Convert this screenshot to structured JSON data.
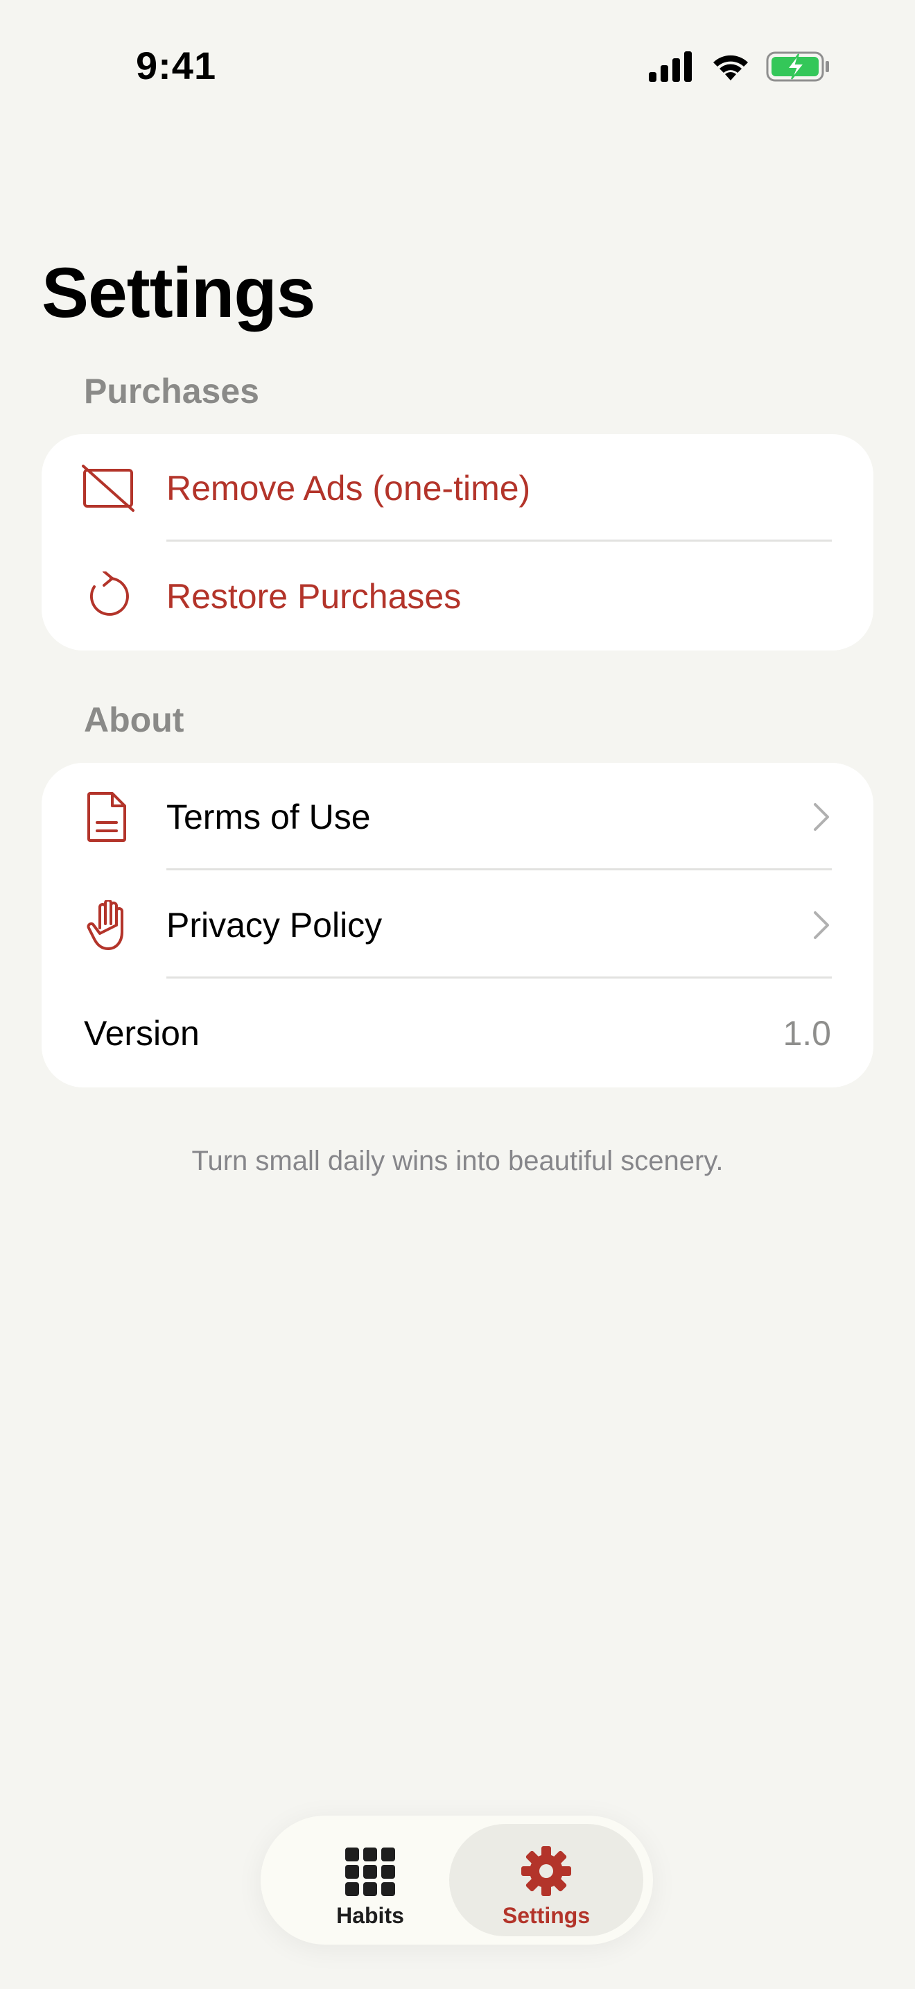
{
  "status_bar": {
    "time": "9:41"
  },
  "page": {
    "title": "Settings"
  },
  "purchases": {
    "header": "Purchases",
    "items": [
      {
        "label": "Remove Ads (one-time)",
        "icon": "no-ads-icon"
      },
      {
        "label": "Restore Purchases",
        "icon": "restore-icon"
      }
    ]
  },
  "about": {
    "header": "About",
    "items": [
      {
        "label": "Terms of Use",
        "icon": "document-icon"
      },
      {
        "label": "Privacy Policy",
        "icon": "hand-icon"
      }
    ],
    "version_label": "Version",
    "version_value": "1.0"
  },
  "tagline": "Turn small daily wins into beautiful scenery.",
  "tab_bar": {
    "tabs": [
      {
        "label": "Habits",
        "icon": "grid-icon",
        "selected": false
      },
      {
        "label": "Settings",
        "icon": "gear-icon",
        "selected": true
      }
    ]
  },
  "colors": {
    "accent": "#b3342a",
    "background": "#f5f5f1",
    "card": "#ffffff",
    "battery": "#34c759"
  }
}
